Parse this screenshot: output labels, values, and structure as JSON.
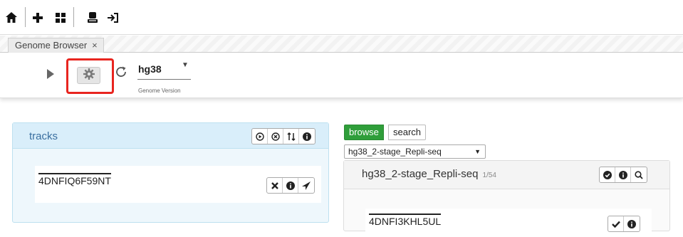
{
  "toolbar": {
    "icons": [
      "home-icon",
      "plus-icon",
      "grid-icon",
      "user-icon",
      "login-icon"
    ]
  },
  "tabs": [
    {
      "label": "Genome Browser",
      "close": "×"
    }
  ],
  "control": {
    "genome_value": "hg38",
    "genome_label": "Genome Version"
  },
  "tracks": {
    "title": "tracks",
    "header_icons": [
      "play-circle-icon",
      "cancel-circle-icon",
      "sort-icon",
      "info-icon"
    ],
    "items": [
      {
        "name": "4DNFIQ6F59NT",
        "icons": [
          "remove-icon",
          "info-icon",
          "send-icon"
        ]
      }
    ]
  },
  "browser": {
    "browse_label": "browse",
    "search_label": "search",
    "dataset_select": "hg38_2-stage_Repli-seq",
    "dataset_title": "hg38_2-stage_Repli-seq",
    "dataset_count": "1/54",
    "header_icons": [
      "check-circle-icon",
      "info-icon",
      "search-icon"
    ],
    "items": [
      {
        "name": "4DNFI3KHL5UL",
        "icons": [
          "check-icon",
          "info-icon"
        ]
      }
    ]
  },
  "colors": {
    "highlight": "#e8251f",
    "browse_tab": "#2f9e3a",
    "tracks_header": "#d9eefa",
    "tracks_title": "#3a6fa0"
  }
}
